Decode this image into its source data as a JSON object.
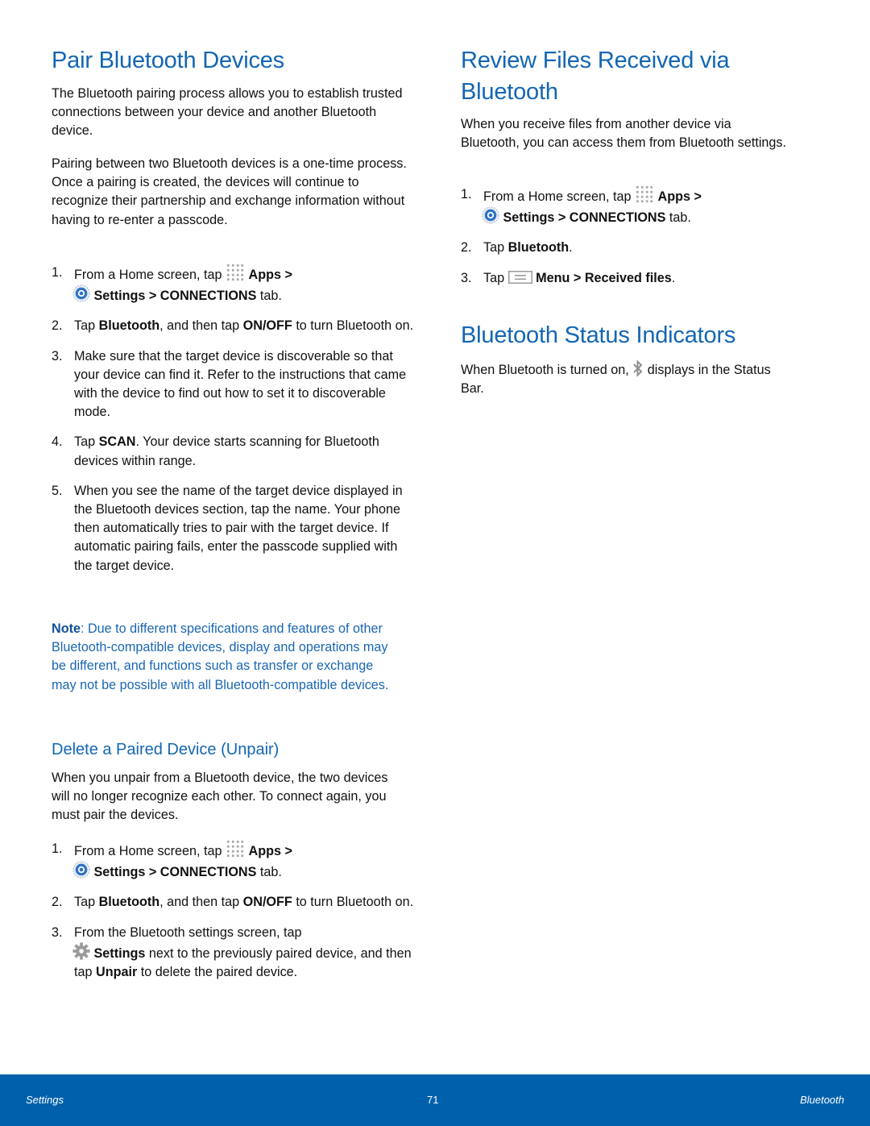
{
  "colors": {
    "heading": "#1366b3",
    "footer_bg": "#0060ab",
    "note": "#1a66b3"
  },
  "left": {
    "title": "Pair Bluetooth Devices",
    "intro1": "The Bluetooth pairing process allows you to establish trusted connections between your device and another Bluetooth device.",
    "intro2": "Pairing between two Bluetooth devices is a one-time process. Once a pairing is created, the devices will continue to recognize their partnership and exchange information without having to re-enter a passcode.",
    "steps": {
      "s1": {
        "num": "1.",
        "a": "From a Home screen, tap",
        "apps": "Apps >",
        "settings": "Settings > CONNECTIONS",
        "tab": "tab."
      },
      "s2": {
        "num": "2.",
        "a": "Tap",
        "b1": "Bluetooth",
        "c": ", and then tap",
        "b2": "ON/OFF",
        "d": "to turn Bluetooth on."
      },
      "s3": {
        "num": "3.",
        "text": "Make sure that the target device is discoverable so that your device can find it. Refer to the instructions that came with the device to find out how to set it to discoverable mode."
      },
      "s4": {
        "num": "4.",
        "a": "Tap",
        "b": "SCAN",
        "c": ". Your device starts scanning for Bluetooth devices within range."
      },
      "s5": {
        "num": "5.",
        "text": "When you see the name of the target device displayed in the Bluetooth devices section, tap the name. Your phone then automatically tries to pair with the target device. If automatic pairing fails, enter the passcode supplied with the target device."
      }
    },
    "note_label": "Note",
    "note_text": ": Due to different specifications and features of other Bluetooth-compatible devices, display and operations may be different, and functions such as transfer or exchange may not be possible with all Bluetooth-compatible devices.",
    "unpair": {
      "title": "Delete a Paired Device (Unpair)",
      "intro": "When you unpair from a Bluetooth device, the two devices will no longer recognize each other. To connect again, you must pair the devices.",
      "s1": {
        "num": "1.",
        "a": "From a Home screen, tap",
        "apps": "Apps >",
        "settings": "Settings > CONNECTIONS",
        "tab": "tab."
      },
      "s2": {
        "num": "2.",
        "a": "Tap",
        "b1": "Bluetooth",
        "c": ", and then tap",
        "b2": "ON/OFF",
        "d": "to turn Bluetooth on."
      },
      "s3": {
        "num": "3.",
        "a": "From the Bluetooth settings screen, tap",
        "b1": "Settings",
        "c": "next to the previously paired device, and then tap",
        "b2": "Unpair",
        "d": "to delete the paired device."
      }
    }
  },
  "right": {
    "title": "Review Files Received via Bluetooth",
    "intro": "When you receive files from another device via Bluetooth, you can access them from Bluetooth settings.",
    "s1": {
      "num": "1.",
      "a": "From a Home screen, tap",
      "apps": "Apps >",
      "settings": "Settings > CONNECTIONS",
      "tab": "tab."
    },
    "s2": {
      "num": "2.",
      "a": "Tap",
      "b": "Bluetooth",
      "c": "."
    },
    "s3": {
      "num": "3.",
      "a": "Tap",
      "b": "Menu > Received files",
      "c": "."
    },
    "status_title": "Bluetooth Status Indicators",
    "status_a": "When Bluetooth is turned on,",
    "status_b": "displays in the Status Bar."
  },
  "footer": {
    "left": "Settings",
    "page": "71",
    "right": "Bluetooth"
  }
}
